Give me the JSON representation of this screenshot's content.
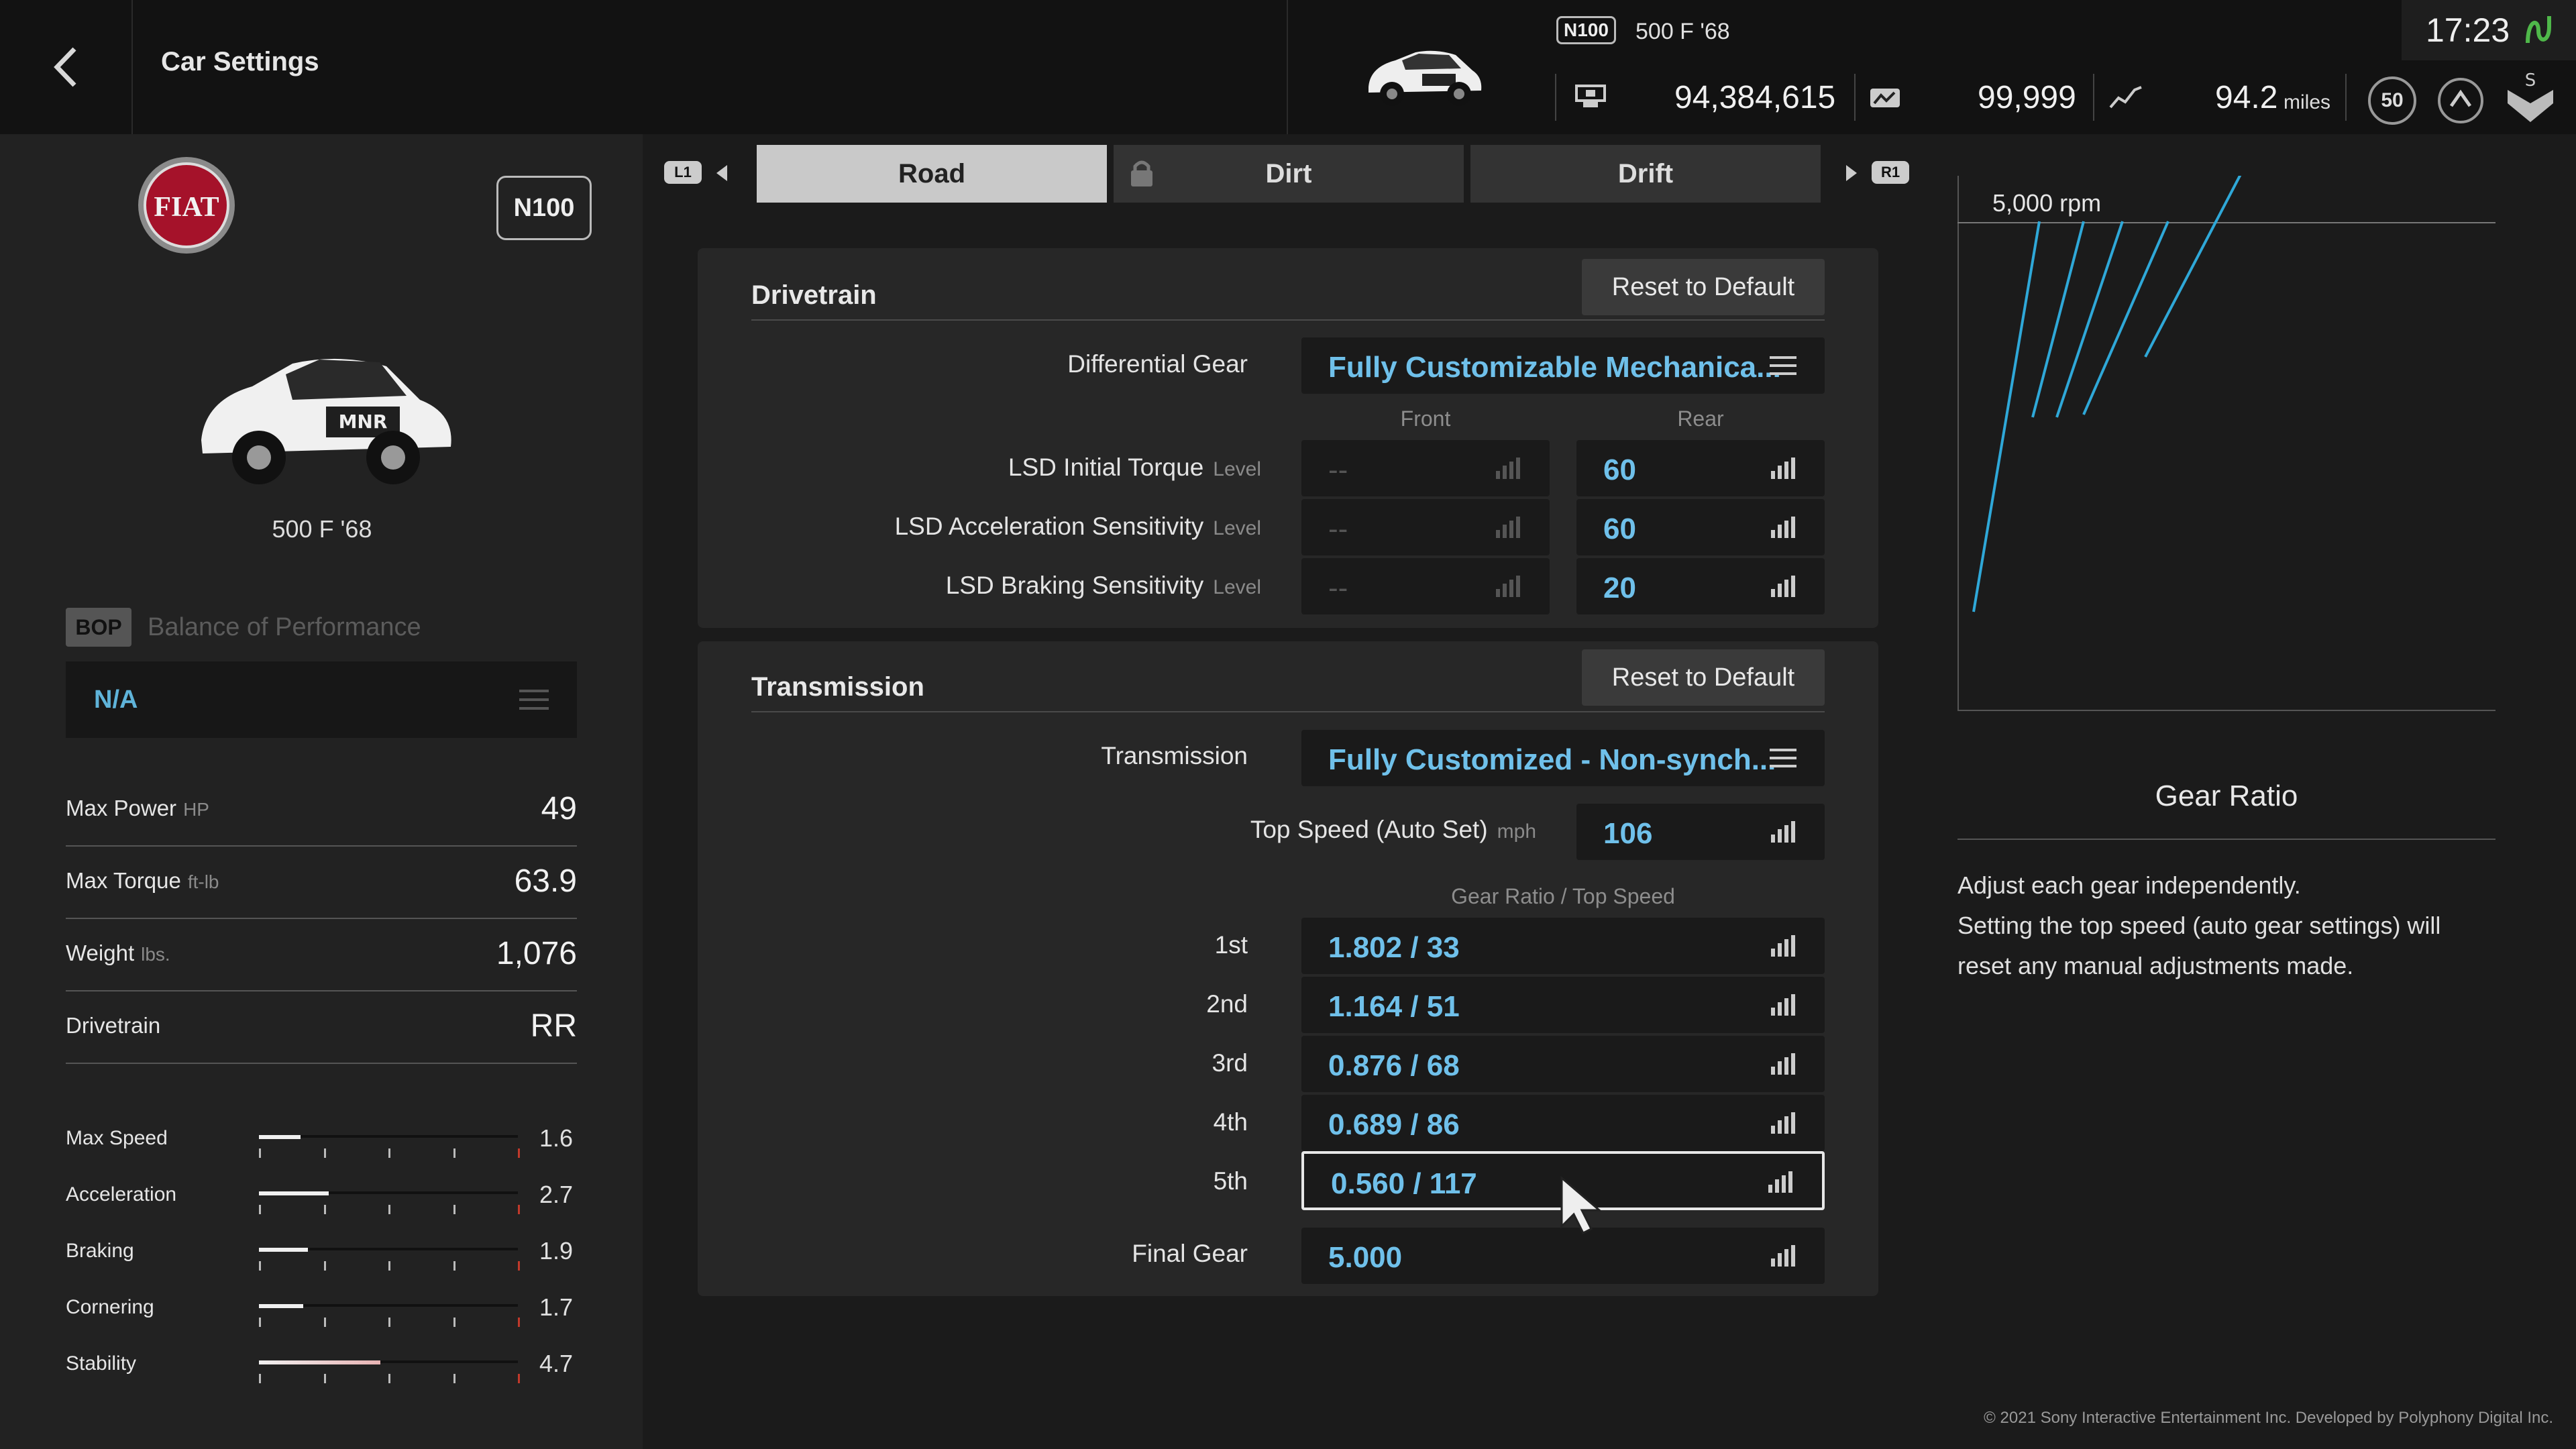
{
  "header": {
    "title": "Car Settings",
    "car_class": "N100",
    "car_name": "500 F '68",
    "credits": "94,384,615",
    "mileage_points": "99,999",
    "distance_value": "94.2",
    "distance_unit": "miles",
    "level": "50",
    "clock": "17:23"
  },
  "left": {
    "class_badge": "N100",
    "car_name": "500 F '68",
    "bop_tag": "BOP",
    "bop_label": "Balance of Performance",
    "bop_value": "N/A",
    "specs": [
      {
        "label": "Max Power",
        "unit": "HP",
        "value": "49"
      },
      {
        "label": "Max Torque",
        "unit": "ft-lb",
        "value": "63.9"
      },
      {
        "label": "Weight",
        "unit": "lbs.",
        "value": "1,076"
      },
      {
        "label": "Drivetrain",
        "unit": "",
        "value": "RR"
      }
    ],
    "performance": [
      {
        "label": "Max Speed",
        "value": "1.6",
        "level": 0.16
      },
      {
        "label": "Acceleration",
        "value": "2.7",
        "level": 0.27
      },
      {
        "label": "Braking",
        "value": "1.9",
        "level": 0.19
      },
      {
        "label": "Cornering",
        "value": "1.7",
        "level": 0.17
      },
      {
        "label": "Stability",
        "value": "4.7",
        "level": 0.47
      }
    ]
  },
  "tabs": {
    "left_shoulder": "L1",
    "right_shoulder": "R1",
    "items": [
      "Road",
      "Dirt",
      "Drift"
    ],
    "active": "Road"
  },
  "drivetrain": {
    "title": "Drivetrain",
    "reset_label": "Reset to Default",
    "differential_label": "Differential Gear",
    "differential_value": "Fully Customizable Mechanica...",
    "front_label": "Front",
    "rear_label": "Rear",
    "rows": [
      {
        "label": "LSD Initial Torque",
        "unit": "Level",
        "front": "--",
        "rear": "60"
      },
      {
        "label": "LSD Acceleration Sensitivity",
        "unit": "Level",
        "front": "--",
        "rear": "60"
      },
      {
        "label": "LSD Braking Sensitivity",
        "unit": "Level",
        "front": "--",
        "rear": "20"
      }
    ]
  },
  "transmission": {
    "title": "Transmission",
    "reset_label": "Reset to Default",
    "transmission_label": "Transmission",
    "transmission_value": "Fully Customized - Non-synch...",
    "top_speed_label": "Top Speed (Auto Set)",
    "top_speed_unit": "mph",
    "top_speed_value": "106",
    "gear_header": "Gear Ratio / Top Speed",
    "gears": [
      {
        "label": "1st",
        "value": "1.802 / 33"
      },
      {
        "label": "2nd",
        "value": "1.164 / 51"
      },
      {
        "label": "3rd",
        "value": "0.876 / 68"
      },
      {
        "label": "4th",
        "value": "0.689 / 86"
      },
      {
        "label": "5th",
        "value": "0.560 / 117"
      }
    ],
    "final_gear_label": "Final Gear",
    "final_gear_value": "5.000"
  },
  "help": {
    "graph_label": "5,000 rpm",
    "title": "Gear Ratio",
    "text_line1": "Adjust each gear independently.",
    "text_line2": "Setting the top speed (auto gear settings) will",
    "text_line3": "reset any manual adjustments made."
  },
  "footer": {
    "copyright": "© 2021 Sony Interactive Entertainment Inc. Developed by Polyphony Digital Inc."
  },
  "colors": {
    "accent_value": "#6fc0ea",
    "panel_bg": "#272727",
    "graph_line": "#2fa8d8"
  }
}
